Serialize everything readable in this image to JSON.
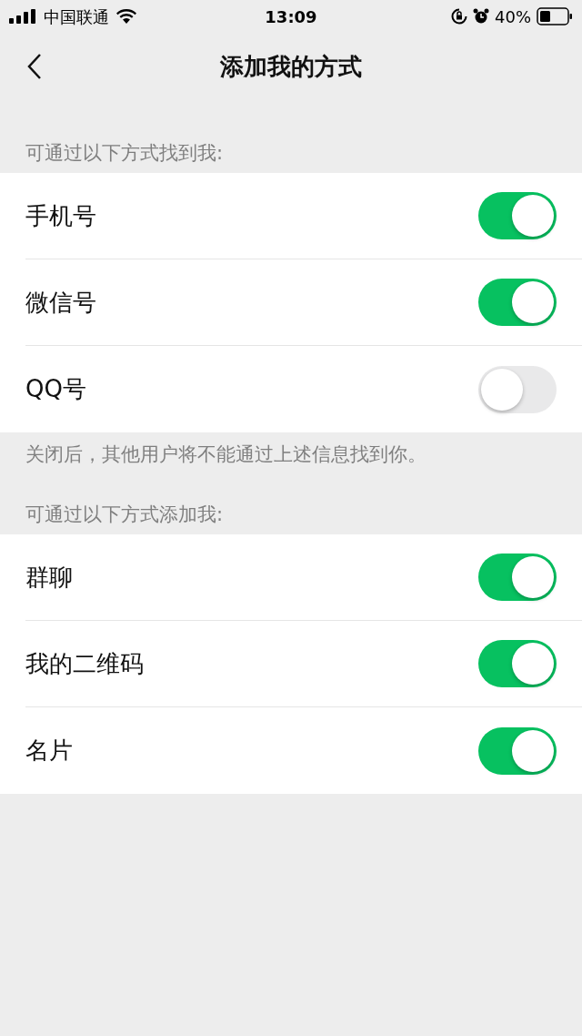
{
  "status_bar": {
    "carrier": "中国联通",
    "time": "13:09",
    "battery": "40%"
  },
  "nav": {
    "title": "添加我的方式"
  },
  "sections": [
    {
      "header": "可通过以下方式找到我:",
      "footer": "关闭后，其他用户将不能通过上述信息找到你。",
      "rows": [
        {
          "label": "手机号",
          "on": true
        },
        {
          "label": "微信号",
          "on": true
        },
        {
          "label": "QQ号",
          "on": false
        }
      ]
    },
    {
      "header": "可通过以下方式添加我:",
      "rows": [
        {
          "label": "群聊",
          "on": true
        },
        {
          "label": "我的二维码",
          "on": true
        },
        {
          "label": "名片",
          "on": true
        }
      ]
    }
  ]
}
